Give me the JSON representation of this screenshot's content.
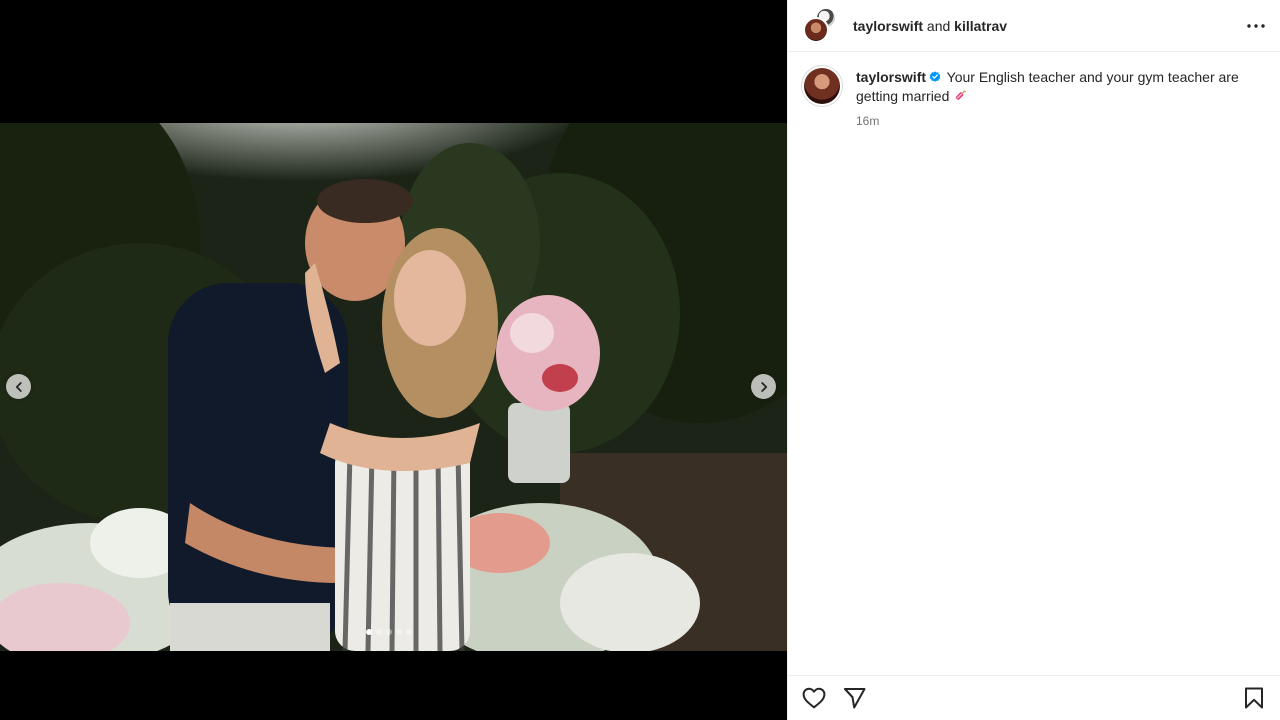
{
  "header": {
    "user1": "taylorswift",
    "joiner": "and",
    "user2": "killatrav",
    "more_icon": "more-horizontal-icon"
  },
  "caption": {
    "username": "taylorswift",
    "verified_icon": "verified-badge-icon",
    "text": "Your English teacher and your gym teacher are getting married",
    "emoji_icon": "dynamite-emoji-icon",
    "time": "16m"
  },
  "carousel": {
    "prev_icon": "chevron-left-icon",
    "next_icon": "chevron-right-icon",
    "slide_count": 5,
    "active_slide": 1
  },
  "actions": {
    "like_icon": "heart-icon",
    "share_icon": "send-icon",
    "save_icon": "bookmark-icon"
  },
  "colors": {
    "verified": "#0095f6",
    "panel_bg": "#ffffff",
    "media_bg": "#000000"
  }
}
